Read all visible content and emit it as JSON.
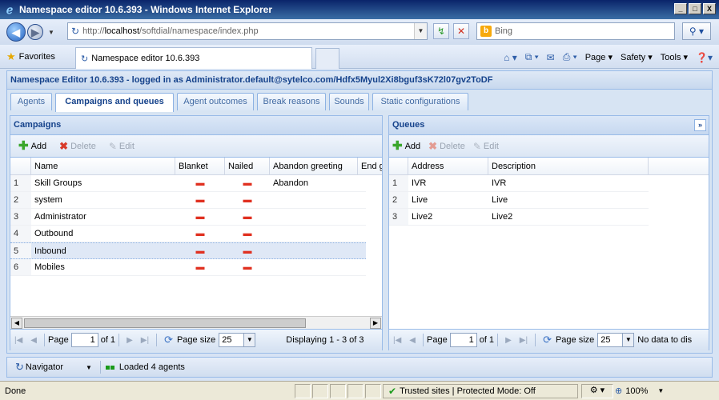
{
  "window": {
    "title": "Namespace editor 10.6.393 - Windows Internet Explorer",
    "controls": [
      "_",
      "□",
      "X"
    ]
  },
  "browser": {
    "url_prefix": "http://",
    "url_host": "localhost",
    "url_path": "/softdial/namespace/index.php",
    "search_placeholder": "Bing",
    "favorites_label": "Favorites",
    "tab_title": "Namespace editor 10.6.393",
    "cmd_page": "Page",
    "cmd_safety": "Safety",
    "cmd_tools": "Tools"
  },
  "app": {
    "header": "Namespace Editor 10.6.393 - logged in as Administrator.default@sytelco.com/Hdfx5Myul2Xi8bguf3sK72l07gv2ToDF",
    "tabs": [
      {
        "label": "Agents"
      },
      {
        "label": "Campaigns and queues"
      },
      {
        "label": "Agent outcomes"
      },
      {
        "label": "Break reasons"
      },
      {
        "label": "Sounds"
      },
      {
        "label": "Static configurations"
      }
    ]
  },
  "campaigns": {
    "title": "Campaigns",
    "toolbar": {
      "add": "Add",
      "delete": "Delete",
      "edit": "Edit"
    },
    "columns": [
      "Name",
      "Blanket",
      "Nailed",
      "Abandon greeting",
      "End g"
    ],
    "rows": [
      {
        "num": "1",
        "name": "Skill Groups",
        "blanket": "▬",
        "nailed": "▬",
        "abandon": "Abandon"
      },
      {
        "num": "2",
        "name": "system",
        "blanket": "▬",
        "nailed": "▬",
        "abandon": ""
      },
      {
        "num": "3",
        "name": "Administrator",
        "blanket": "▬",
        "nailed": "▬",
        "abandon": ""
      },
      {
        "num": "4",
        "name": "Outbound",
        "blanket": "▬",
        "nailed": "▬",
        "abandon": ""
      },
      {
        "num": "5",
        "name": "Inbound",
        "blanket": "▬",
        "nailed": "▬",
        "abandon": ""
      },
      {
        "num": "6",
        "name": "Mobiles",
        "blanket": "▬",
        "nailed": "▬",
        "abandon": ""
      }
    ],
    "pager": {
      "page_label": "Page",
      "page_value": "1",
      "of": "of 1",
      "size_label": "Page size",
      "size_value": "25",
      "display": "Displaying 1 - 3 of 3"
    }
  },
  "queues": {
    "title": "Queues",
    "toolbar": {
      "add": "Add",
      "delete": "Delete",
      "edit": "Edit"
    },
    "columns": [
      "Address",
      "Description"
    ],
    "rows": [
      {
        "num": "1",
        "address": "IVR",
        "description": "IVR"
      },
      {
        "num": "2",
        "address": "Live",
        "description": "Live"
      },
      {
        "num": "3",
        "address": "Live2",
        "description": "Live2"
      }
    ],
    "pager": {
      "page_label": "Page",
      "page_value": "1",
      "of": "of 1",
      "size_label": "Page size",
      "size_value": "25",
      "display": "No data to dis"
    }
  },
  "bottom": {
    "navigator": "Navigator",
    "status": "Loaded 4 agents"
  },
  "statusbar": {
    "done": "Done",
    "zone": "Trusted sites | Protected Mode: Off",
    "zoom": "100%"
  }
}
